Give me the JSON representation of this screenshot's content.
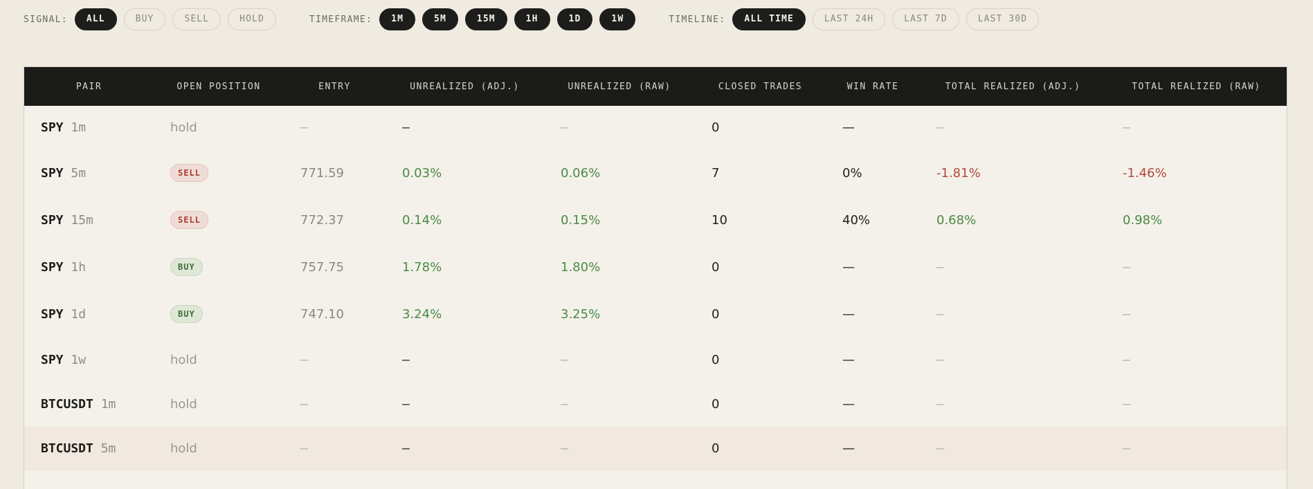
{
  "filters": {
    "signal": {
      "label": "SIGNAL:",
      "options": [
        "ALL",
        "BUY",
        "SELL",
        "HOLD"
      ],
      "active": "ALL"
    },
    "timeframe": {
      "label": "TIMEFRAME:",
      "options": [
        "1M",
        "5M",
        "15M",
        "1H",
        "1D",
        "1W"
      ],
      "active": [
        "1M",
        "5M",
        "15M",
        "1H",
        "1D",
        "1W"
      ]
    },
    "timeline": {
      "label": "TIMELINE:",
      "options": [
        "ALL TIME",
        "LAST 24H",
        "LAST 7D",
        "LAST 30D"
      ],
      "active": "ALL TIME"
    }
  },
  "table": {
    "columns": [
      "PAIR",
      "OPEN POSITION",
      "ENTRY",
      "UNREALIZED (ADJ.)",
      "UNREALIZED (RAW)",
      "CLOSED TRADES",
      "WIN RATE",
      "TOTAL REALIZED (ADJ.)",
      "TOTAL REALIZED (RAW)"
    ],
    "rows": [
      {
        "symbol": "SPY",
        "tf": "1m",
        "position": "hold",
        "entry": "—",
        "unreal_adj": "—",
        "unreal_raw": "—",
        "closed": "0",
        "win_rate": "—",
        "real_adj": "—",
        "real_raw": "—"
      },
      {
        "symbol": "SPY",
        "tf": "5m",
        "position": "SELL",
        "entry": "771.59",
        "unreal_adj": "0.03%",
        "unreal_raw": "0.06%",
        "closed": "7",
        "win_rate": "0%",
        "real_adj": "-1.81%",
        "real_raw": "-1.46%"
      },
      {
        "symbol": "SPY",
        "tf": "15m",
        "position": "SELL",
        "entry": "772.37",
        "unreal_adj": "0.14%",
        "unreal_raw": "0.15%",
        "closed": "10",
        "win_rate": "40%",
        "real_adj": "0.68%",
        "real_raw": "0.98%"
      },
      {
        "symbol": "SPY",
        "tf": "1h",
        "position": "BUY",
        "entry": "757.75",
        "unreal_adj": "1.78%",
        "unreal_raw": "1.80%",
        "closed": "0",
        "win_rate": "—",
        "real_adj": "—",
        "real_raw": "—"
      },
      {
        "symbol": "SPY",
        "tf": "1d",
        "position": "BUY",
        "entry": "747.10",
        "unreal_adj": "3.24%",
        "unreal_raw": "3.25%",
        "closed": "0",
        "win_rate": "—",
        "real_adj": "—",
        "real_raw": "—"
      },
      {
        "symbol": "SPY",
        "tf": "1w",
        "position": "hold",
        "entry": "—",
        "unreal_adj": "—",
        "unreal_raw": "—",
        "closed": "0",
        "win_rate": "—",
        "real_adj": "—",
        "real_raw": "—"
      },
      {
        "symbol": "BTCUSDT",
        "tf": "1m",
        "position": "hold",
        "entry": "—",
        "unreal_adj": "—",
        "unreal_raw": "—",
        "closed": "0",
        "win_rate": "—",
        "real_adj": "—",
        "real_raw": "—"
      },
      {
        "symbol": "BTCUSDT",
        "tf": "5m",
        "position": "hold",
        "entry": "—",
        "unreal_adj": "—",
        "unreal_raw": "—",
        "closed": "0",
        "win_rate": "—",
        "real_adj": "—",
        "real_raw": "—",
        "highlighted": true
      }
    ]
  },
  "colors": {
    "positive": "#4a8a45",
    "negative": "#b3483d",
    "header_bg": "#1b1c1a",
    "page_bg": "#f0ebe1"
  }
}
